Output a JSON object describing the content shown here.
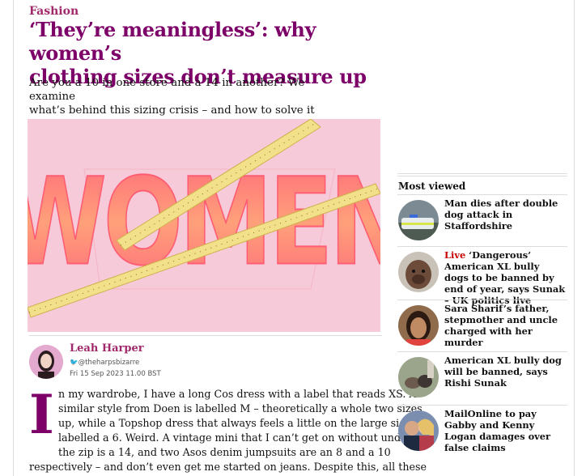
{
  "article": {
    "kicker": "Fashion",
    "headline_line1": "‘They’re meaningless’: why women’s",
    "headline_line2": "clothing sizes don’t measure up",
    "standfirst_line1": "Are you a 10 in one store and a 14 in another? We examine",
    "standfirst_line2": "what’s behind this sizing crisis – and how to solve it",
    "hero_word": "WOMEN",
    "author": "Leah Harper",
    "handle": "@theharpsbizarre",
    "date": "Fri 15 Sep 2023 11.00 BST",
    "dropcap": "I",
    "body_lines": [
      "n my wardrobe, I have a long Cos dress with a label that reads XS. A",
      "similar style from Doen is labelled M – theoretically a whole two sizes",
      "up, while a Topshop dress that always feels a little on the large side is",
      "labelled a 6. Weird. A vintage mini that I can’t get on without undoing",
      "the zip is a 14, and two Asos denim jumpsuits are an 8 and a 10",
      "respectively – and don’t even get me started on jeans. Despite this, all these"
    ]
  },
  "most_viewed": {
    "title": "Most viewed",
    "items": [
      {
        "live": "",
        "text": "Man dies after double dog attack in Staffordshire",
        "icon": "police-car-thumbnail"
      },
      {
        "live": "Live",
        "text": "‘Dangerous’ American XL bully dogs to be banned by end of year, says Sunak – UK politics live",
        "icon": "bully-dog-thumbnail"
      },
      {
        "live": "",
        "text": "Sara Sharif’s father, stepmother and uncle charged with her murder",
        "icon": "girl-portrait-thumbnail"
      },
      {
        "live": "",
        "text": "American XL bully dog will be banned, says Rishi Sunak",
        "icon": "dogs-on-lead-thumbnail"
      },
      {
        "live": "",
        "text": "MailOnline to pay Gabby and Kenny Logan damages over false claims",
        "icon": "couple-thumbnail"
      }
    ]
  },
  "colors": {
    "headline": "#7d0068",
    "kicker": "#a1286b",
    "hero_bg": "#f6cad9",
    "live": "#c70000"
  }
}
